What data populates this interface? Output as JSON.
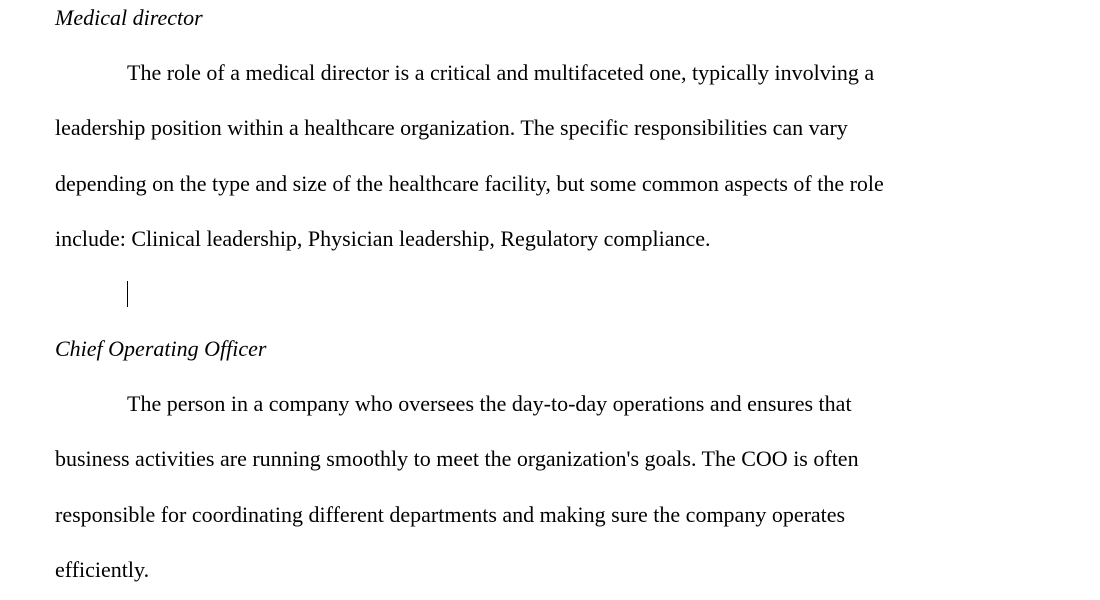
{
  "document": {
    "sections": [
      {
        "heading": "Medical director",
        "lines": [
          "The role of a medical director is a critical and multifaceted one, typically involving a",
          "leadership position within a healthcare organization. The specific responsibilities can vary",
          "depending on the type and size of the healthcare facility, but some common aspects of the role",
          "include: Clinical leadership, Physician leadership, Regulatory compliance."
        ]
      },
      {
        "heading": "Chief Operating Officer",
        "lines": [
          "The person in a company who oversees the day-to-day operations and ensures that",
          "business activities are running smoothly to meet the organization's goals. The COO is often",
          "responsible for coordinating different departments and making sure the company operates",
          "efficiently."
        ]
      }
    ]
  }
}
